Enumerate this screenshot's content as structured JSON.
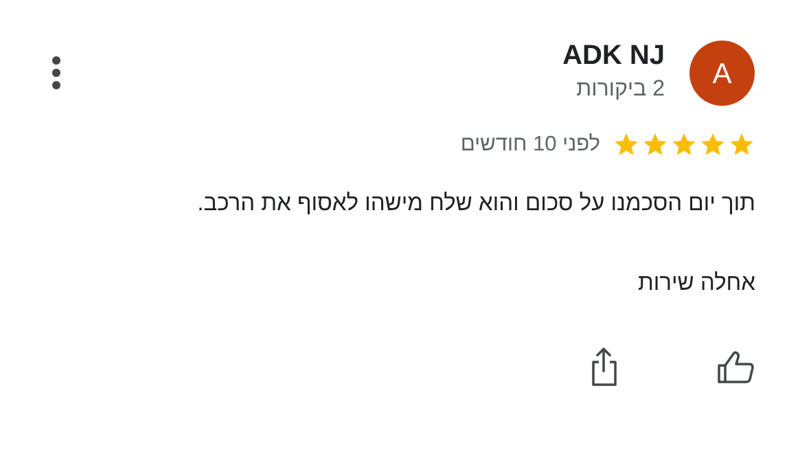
{
  "review": {
    "author": {
      "avatar_letter": "A",
      "avatar_color": "#c5400f",
      "name": "ADK NJ",
      "reviews_count": "2 ביקורות"
    },
    "rating": {
      "stars": 5,
      "max_stars": 5,
      "star_color": "#fbbc04"
    },
    "time_ago": "לפני 10 חודשים",
    "text_line_1": "תוך יום הסכמנו על סכום והוא שלח מישהו לאסוף את הרכב.",
    "text_line_2": "אחלה שירות",
    "actions": {
      "like_icon": "thumbs-up-icon",
      "share_icon": "share-icon",
      "menu_icon": "more-vert-icon"
    }
  }
}
